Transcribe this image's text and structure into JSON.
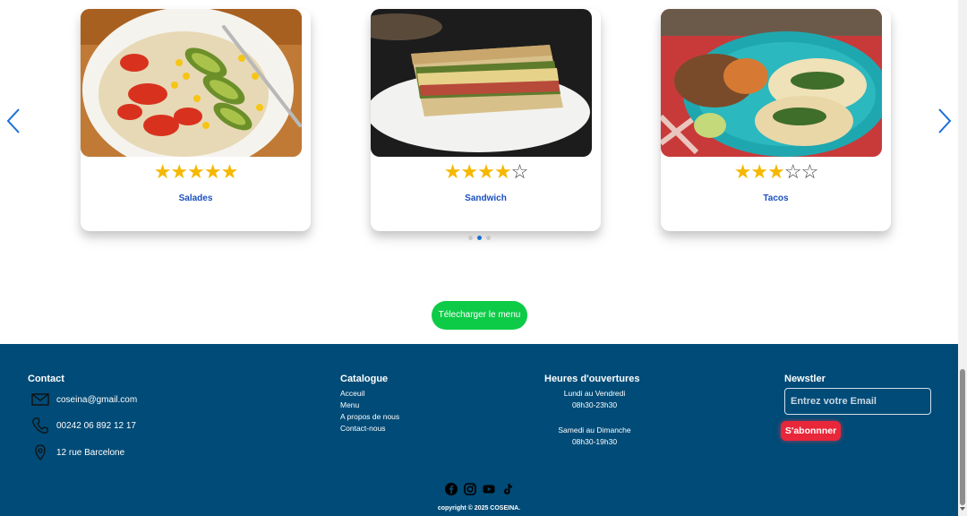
{
  "carousel": {
    "cards": [
      {
        "title": "Salades",
        "rating": 5,
        "stars": "★★★★★",
        "stars_off": "",
        "image": "salad-photo"
      },
      {
        "title": "Sandwich",
        "rating": 4,
        "stars": "★★★★",
        "stars_off": "☆",
        "image": "sandwich-photo"
      },
      {
        "title": "Tacos",
        "rating": 3,
        "stars": "★★★",
        "stars_off": "☆☆",
        "image": "tacos-photo"
      }
    ],
    "pagination": {
      "count": 3,
      "active": 2
    },
    "prev_icon": "chevron-left-icon",
    "next_icon": "chevron-right-icon"
  },
  "download_button": "Télecharger le menu",
  "footer": {
    "contact": {
      "heading": "Contact",
      "email": "coseina@gmail.com",
      "phone": "00242 06 892 12 17",
      "address": "12 rue Barcelone"
    },
    "catalogue": {
      "heading": "Catalogue",
      "items": [
        "Acceuil",
        "Menu",
        "A propos de nous",
        "Contact-nous"
      ]
    },
    "hours": {
      "heading": "Heures d'ouvertures",
      "weekday_label": "Lundi au Vendredi",
      "weekday_time": "08h30-23h30",
      "weekend_label": "Samedi au Dimanche",
      "weekend_time": "08h30-19h30"
    },
    "newsletter": {
      "heading": "Newstler",
      "placeholder": "Entrez votre Email",
      "button": "S'abonnner"
    },
    "socials": [
      "facebook-icon",
      "instagram-icon",
      "youtube-icon",
      "tiktok-icon"
    ],
    "copyright": "copyright © 2025 COSEINA."
  },
  "colors": {
    "footer_bg": "#004b77",
    "download_button": "#0ecb47",
    "subscribe_button": "#e8273a",
    "star": "#f5b800",
    "link_blue": "#1a4fbf"
  }
}
